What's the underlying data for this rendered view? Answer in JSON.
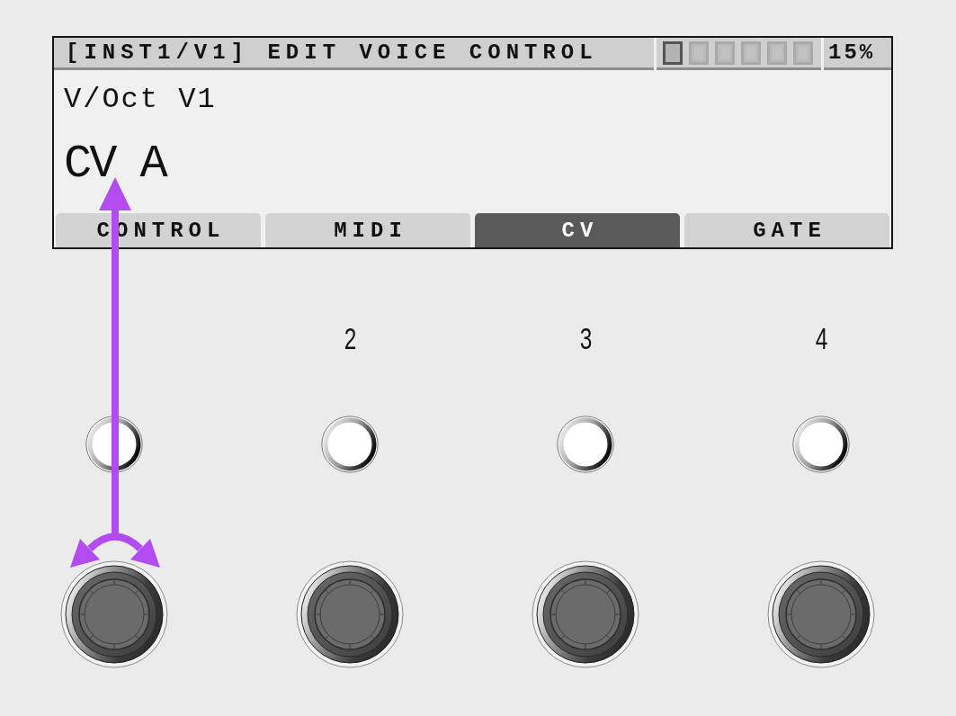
{
  "screen": {
    "title": "[INST1/V1] EDIT VOICE CONTROL",
    "pages": [
      {
        "selected": true
      },
      {
        "selected": false
      },
      {
        "selected": false
      },
      {
        "selected": false
      },
      {
        "selected": false
      },
      {
        "selected": false
      }
    ],
    "percent": "15%",
    "parameter": "V/Oct V1",
    "value": "CV A",
    "tabs": [
      {
        "label": "CONTROL",
        "selected": false
      },
      {
        "label": "MIDI",
        "selected": false
      },
      {
        "label": "CV",
        "selected": true
      },
      {
        "label": "GATE",
        "selected": false
      }
    ]
  },
  "channel_numbers": [
    "2",
    "3",
    "4"
  ]
}
